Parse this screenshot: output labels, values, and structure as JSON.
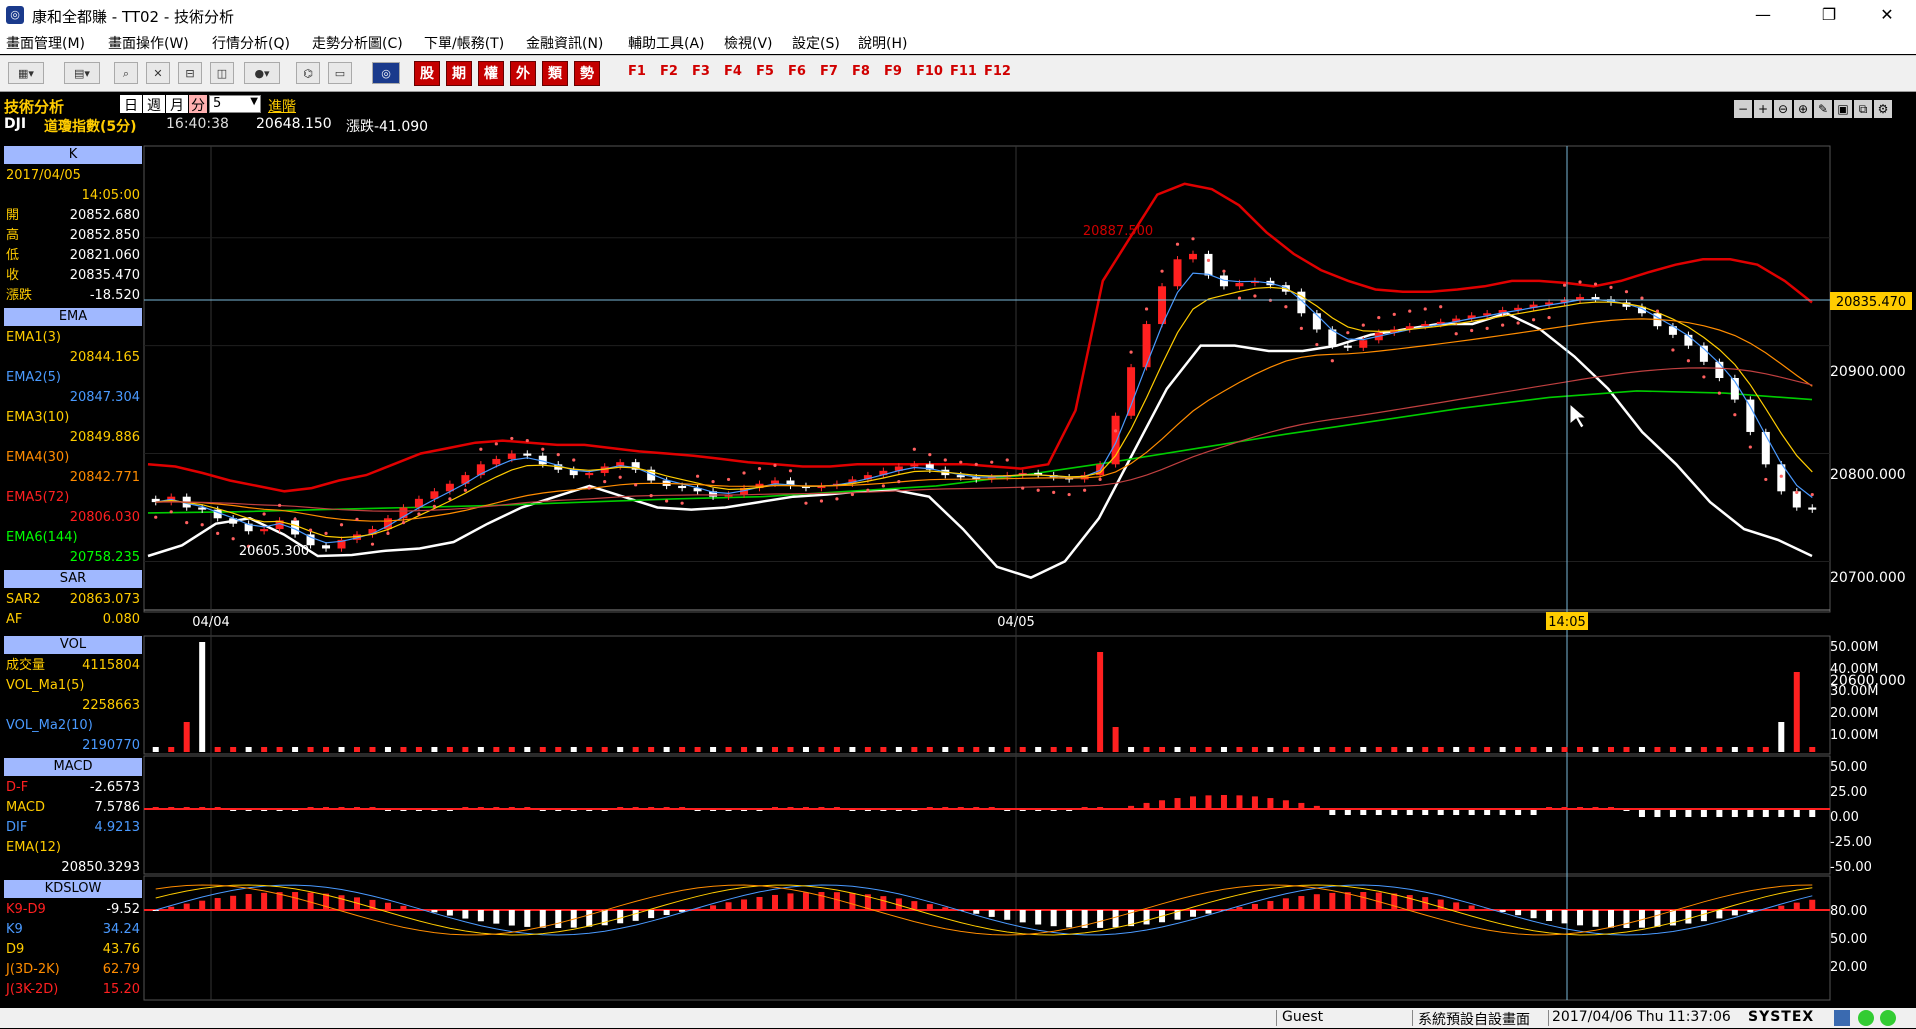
{
  "window": {
    "title": "康和全都賺 - TT02 - 技術分析",
    "minimize": "—",
    "restore": "❐",
    "close": "✕"
  },
  "menu": [
    "畫面管理(M)",
    "畫面操作(W)",
    "行情分析(Q)",
    "走勢分析圖(C)",
    "下單/帳務(T)",
    "金融資訊(N)",
    "輔助工具(A)",
    "檢視(V)",
    "設定(S)",
    "說明(H)"
  ],
  "toolbar": {
    "quick": [
      "股",
      "期",
      "權",
      "外",
      "類",
      "勢"
    ],
    "fkeys": [
      "F1",
      "F2",
      "F3",
      "F4",
      "F5",
      "F6",
      "F7",
      "F8",
      "F9",
      "F10",
      "F11",
      "F12"
    ]
  },
  "info": {
    "title": "技術分析",
    "periods": [
      "日",
      "週",
      "月",
      "分"
    ],
    "interval": "5",
    "advanced": "進階",
    "symbol": "DJI",
    "name": "道瓊指數(5分)",
    "time": "16:40:38",
    "price": "20648.150",
    "change": "漲跌-41.090"
  },
  "panel_k": {
    "header": "K",
    "date": "2017/04/05",
    "time": "14:05:00",
    "rows": [
      {
        "k": "開",
        "v": "20852.680"
      },
      {
        "k": "高",
        "v": "20852.850"
      },
      {
        "k": "低",
        "v": "20821.060"
      },
      {
        "k": "收",
        "v": "20835.470"
      },
      {
        "k": "漲跌",
        "v": "-18.520"
      }
    ]
  },
  "panel_ema": {
    "header": "EMA",
    "rows": [
      {
        "k": "EMA1(3)",
        "v": "20844.165",
        "color": "#ffcc00"
      },
      {
        "k": "EMA2(5)",
        "v": "20847.304",
        "color": "#4a9aff"
      },
      {
        "k": "EMA3(10)",
        "v": "20849.886",
        "color": "#ffcc00"
      },
      {
        "k": "EMA4(30)",
        "v": "20842.771",
        "color": "#ff8c00"
      },
      {
        "k": "EMA5(72)",
        "v": "20806.030",
        "color": "#ff2020"
      },
      {
        "k": "EMA6(144)",
        "v": "20758.235",
        "color": "#00ff00"
      }
    ]
  },
  "panel_sar": {
    "header": "SAR",
    "rows": [
      {
        "k": "SAR2",
        "v": "20863.073"
      },
      {
        "k": "AF",
        "v": "0.080"
      }
    ]
  },
  "panel_vol": {
    "header": "VOL",
    "rows": [
      {
        "k": "成交量",
        "v": "4115804"
      },
      {
        "k": "VOL_Ma1(5)",
        "v": ""
      },
      {
        "k": "",
        "v": "2258663"
      },
      {
        "k": "VOL_Ma2(10)",
        "v": ""
      },
      {
        "k": "",
        "v": "2190770"
      }
    ]
  },
  "panel_macd": {
    "header": "MACD",
    "rows": [
      {
        "k": "D-F",
        "v": "-2.6573"
      },
      {
        "k": "MACD",
        "v": "7.5786"
      },
      {
        "k": "DIF",
        "v": "4.9213"
      },
      {
        "k": "EMA(12)",
        "v": ""
      },
      {
        "k": "",
        "v": "20850.3293"
      }
    ]
  },
  "panel_kd": {
    "header": "KDSLOW",
    "rows": [
      {
        "k": "K9-D9",
        "v": "-9.52"
      },
      {
        "k": "K9",
        "v": "34.24"
      },
      {
        "k": "D9",
        "v": "43.76"
      },
      {
        "k": "J(3D-2K)",
        "v": "62.79"
      },
      {
        "k": "J(3K-2D)",
        "v": "15.20"
      }
    ]
  },
  "chart_data": [
    {
      "type": "candlestick",
      "ylim": [
        20555,
        20985
      ],
      "yticks": [
        "20900.000",
        "20800.000",
        "20700.000",
        "20600.000"
      ],
      "ytick_values": [
        20900,
        20800,
        20700,
        20600
      ],
      "xticks": [
        "04/04",
        "04/05"
      ],
      "cursor_label": "14:05",
      "cursor_price": "20835.470",
      "annotations": [
        {
          "text": "20887.500",
          "value": 20887.5
        },
        {
          "text": "20605.300",
          "value": 20605.3
        }
      ],
      "close": [
        20655,
        20660,
        20650,
        20648,
        20640,
        20635,
        20628,
        20630,
        20638,
        20625,
        20615,
        20612,
        20620,
        20625,
        20630,
        20640,
        20650,
        20658,
        20665,
        20672,
        20680,
        20690,
        20695,
        20700,
        20698,
        20690,
        20685,
        20680,
        20682,
        20688,
        20692,
        20685,
        20675,
        20670,
        20668,
        20665,
        20660,
        20662,
        20668,
        20672,
        20675,
        20670,
        20668,
        20670,
        20672,
        20676,
        20680,
        20684,
        20688,
        20690,
        20685,
        20680,
        20678,
        20676,
        20678,
        20680,
        20682,
        20680,
        20678,
        20676,
        20680,
        20690,
        20735,
        20780,
        20820,
        20855,
        20880,
        20885,
        20865,
        20855,
        20858,
        20860,
        20856,
        20850,
        20830,
        20815,
        20800,
        20798,
        20805,
        20812,
        20815,
        20818,
        20820,
        20822,
        20825,
        20828,
        20830,
        20833,
        20835,
        20838,
        20840,
        20842,
        20845,
        20843,
        20840,
        20836,
        20830,
        20818,
        20810,
        20800,
        20785,
        20770,
        20750,
        20720,
        20690,
        20665,
        20650,
        20648
      ],
      "upper_band": [
        20690,
        20688,
        20682,
        20675,
        20670,
        20665,
        20668,
        20675,
        20680,
        20690,
        20700,
        20705,
        20710,
        20712,
        20710,
        20708,
        20708,
        20705,
        20702,
        20700,
        20698,
        20695,
        20692,
        20690,
        20688,
        20688,
        20690,
        20690,
        20690,
        20690,
        20690,
        20688,
        20686,
        20690,
        20740,
        20860,
        20900,
        20940,
        20950,
        20945,
        20930,
        20905,
        20885,
        20870,
        20860,
        20852,
        20850,
        20850,
        20852,
        20855,
        20860,
        20860,
        20858,
        20855,
        20860,
        20868,
        20875,
        20880,
        20880,
        20875,
        20860,
        20840
      ],
      "lower_band": [
        20605,
        20615,
        20635,
        20640,
        20625,
        20605,
        20606,
        20610,
        20612,
        20618,
        20635,
        20650,
        20660,
        20670,
        20660,
        20650,
        20648,
        20650,
        20655,
        20660,
        20662,
        20665,
        20666,
        20660,
        20630,
        20595,
        20585,
        20600,
        20640,
        20700,
        20760,
        20800,
        20800,
        20795,
        20795,
        20800,
        20810,
        20815,
        20820,
        20820,
        20830,
        20815,
        20790,
        20760,
        20720,
        20690,
        20655,
        20630,
        20620,
        20605
      ],
      "ema6": [
        20645,
        20646,
        20648,
        20650,
        20652,
        20655,
        20658,
        20660,
        20665,
        20670,
        20680,
        20692,
        20705,
        20718,
        20730,
        20742,
        20752,
        20758,
        20756,
        20750
      ]
    },
    {
      "type": "bar",
      "name": "VOL",
      "yticks": [
        "50.00M",
        "40.00M",
        "30.00M",
        "20.00M",
        "10.00M"
      ],
      "ytick_values": [
        50,
        40,
        30,
        20,
        10
      ]
    },
    {
      "type": "bar",
      "name": "MACD",
      "yticks": [
        "50.00",
        "25.00",
        "0.00",
        "-25.00",
        "-50.00"
      ],
      "ytick_values": [
        50,
        25,
        0,
        -25,
        -50
      ]
    },
    {
      "type": "line",
      "name": "KDSLOW",
      "yticks": [
        "80.00",
        "50.00",
        "20.00"
      ],
      "ytick_values": [
        80,
        50,
        20
      ]
    }
  ],
  "status": {
    "user": "Guest",
    "layout": "系統預設自設畫面",
    "datetime": "2017/04/06 Thu 11:37:06",
    "brand": "SYSTEX"
  }
}
